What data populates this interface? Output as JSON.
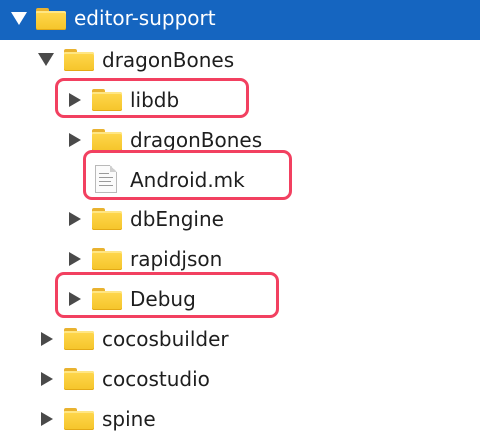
{
  "tree": {
    "items": [
      {
        "label": "editor-support",
        "type": "folder",
        "expanded": true,
        "selected": true
      },
      {
        "label": "dragonBones",
        "type": "folder",
        "expanded": true
      },
      {
        "label": "libdb",
        "type": "folder",
        "expanded": false
      },
      {
        "label": "dragonBones",
        "type": "folder",
        "expanded": false
      },
      {
        "label": "Android.mk",
        "type": "file",
        "icon": "document-icon"
      },
      {
        "label": "dbEngine",
        "type": "folder",
        "expanded": false
      },
      {
        "label": "rapidjson",
        "type": "folder",
        "expanded": false
      },
      {
        "label": "Debug",
        "type": "folder",
        "expanded": false
      },
      {
        "label": "cocosbuilder",
        "type": "folder",
        "expanded": false
      },
      {
        "label": "cocostudio",
        "type": "folder",
        "expanded": false
      },
      {
        "label": "spine",
        "type": "folder",
        "expanded": false
      }
    ]
  },
  "colors": {
    "selection": "#1565c0",
    "highlight": "#f24060",
    "folder": "#f5c52a",
    "disclosure": "#4a4a4a"
  }
}
